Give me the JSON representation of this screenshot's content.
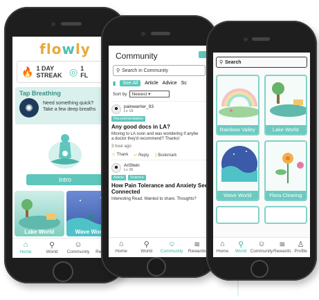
{
  "phone1": {
    "logo": "flowly",
    "streak": {
      "count_label": "1 DAY",
      "unit_label": "STREAK"
    },
    "flow": {
      "count_label": "1",
      "unit_label": "FL"
    },
    "tap_card": {
      "title": "Tap Breathing",
      "line1": "Need something quick?",
      "line2": "Take a few deep breaths"
    },
    "intro_button": "Intro",
    "worlds": [
      "Lake World",
      "Wave World"
    ],
    "tabs": [
      "Home",
      "World",
      "Community",
      "Rewards"
    ]
  },
  "phone2": {
    "title": "Community",
    "search_placeholder": "Search in Community",
    "filter_tabs": [
      "See All",
      "Article",
      "Advice",
      "Sc"
    ],
    "sort_label": "Sort by",
    "sort_value": "Newest",
    "posts": [
      {
        "user": "painwarrier_93",
        "level": "Lv 19",
        "tags": [
          "Recommendation"
        ],
        "title": "Any good docs in LA?",
        "body1": "Moving to LA soon and was wondering if anybe",
        "body2": "a doctor they'd recommend? Thanks!",
        "time": "3 hour ago",
        "actions": [
          "Thank",
          "Reply",
          "Bookmark"
        ]
      },
      {
        "user": "AriStein",
        "level": "Lv 26",
        "tags": [
          "Article",
          "Science"
        ],
        "title": "How Pain Tolerance and Anxiety Seem",
        "title2": "Connected",
        "body1": "Interesting Read. Wanted to share. Thoughts?"
      }
    ],
    "tabs": [
      "Home",
      "World",
      "Community",
      "Rewards"
    ]
  },
  "phone3": {
    "search_placeholder": "Search",
    "worlds": [
      "Rainbow Valley",
      "Lake World",
      "Wave World",
      "Flora Clearing"
    ],
    "tabs": [
      "Home",
      "World",
      "Community",
      "Rewards",
      "Profile"
    ]
  },
  "colors": {
    "accent": "#5ec6bc",
    "brand_orange": "#e8a93a",
    "frame": "#1e1e1e"
  }
}
